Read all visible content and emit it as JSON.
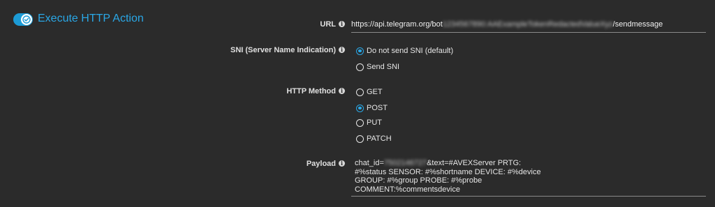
{
  "section": {
    "title": "Execute HTTP Action",
    "enabled": true
  },
  "fields": {
    "url": {
      "label": "URL",
      "value_prefix": "https://api.telegram.org/bot",
      "value_redacted": "1234567890:AAExampleTokenRedactedValueXyz",
      "value_suffix": "/sendmessage"
    },
    "sni": {
      "label": "SNI (Server Name Indication)",
      "options": [
        "Do not send SNI (default)",
        "Send SNI"
      ],
      "selected": "Do not send SNI (default)"
    },
    "method": {
      "label": "HTTP Method",
      "options": [
        "GET",
        "POST",
        "PUT",
        "PATCH"
      ],
      "selected": "POST"
    },
    "payload": {
      "label": "Payload",
      "line1_prefix": "chat_id=",
      "line1_redacted": "7502146727",
      "line1_suffix": "&text=#AVEXServer PRTG:",
      "line2": "#%status SENSOR: #%shortname DEVICE: #%device",
      "line3": "GROUP: #%group PROBE: #%probe",
      "line4": "COMMENT:%commentsdevice"
    }
  },
  "colors": {
    "accent": "#2aa7e6",
    "background": "#2b2b2b",
    "text": "#e6e6e6"
  },
  "icons": {
    "info": "info-icon",
    "toggle_check": "check-icon"
  }
}
